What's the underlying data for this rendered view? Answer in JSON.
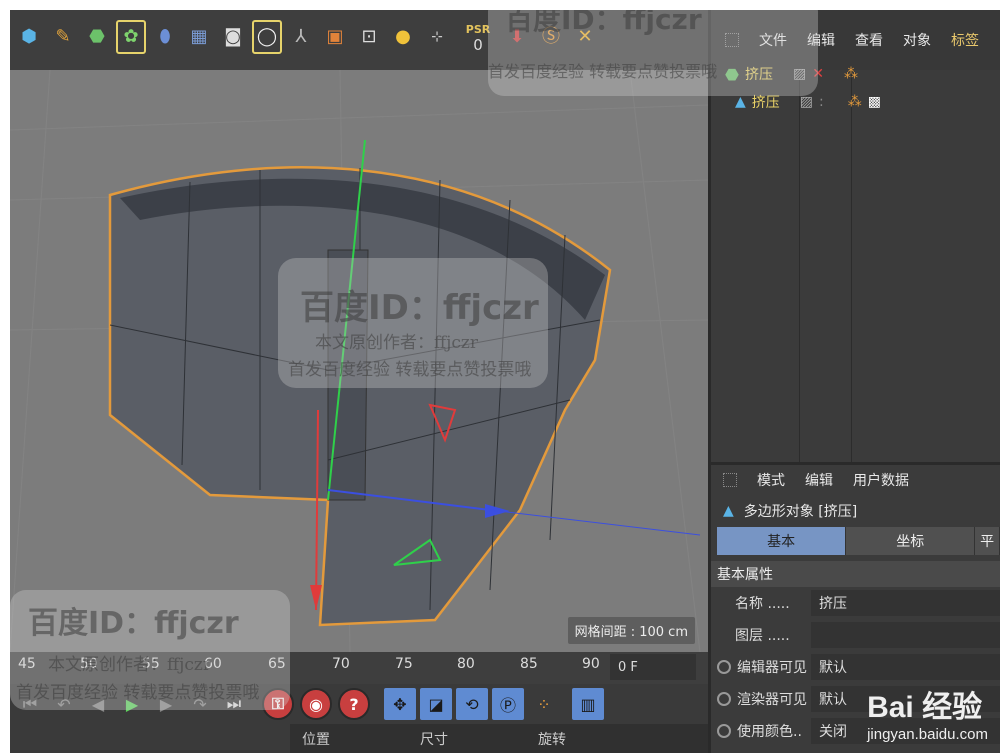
{
  "toolbar": {
    "icons": [
      "cube-icon",
      "pen-icon",
      "extrude-icon",
      "cloner-icon",
      "deformer-icon",
      "floor-icon",
      "camera-icon",
      "light-icon",
      "joint-icon",
      "render-icon",
      "render-settings-icon",
      "point-light-icon",
      "axis-icon"
    ],
    "psr_label": "PSR",
    "psr_value": "0"
  },
  "object_manager": {
    "menu": [
      "文件",
      "编辑",
      "查看",
      "对象",
      "标签"
    ],
    "active_menu": "标签",
    "objects": [
      {
        "name": "挤压",
        "icon": "extrude-icon"
      },
      {
        "name": "挤压",
        "icon": "polygon-icon"
      }
    ]
  },
  "attribute_manager": {
    "menu": [
      "模式",
      "编辑",
      "用户数据"
    ],
    "object_title": "多边形对象 [挤压]",
    "tabs": [
      "基本",
      "坐标",
      "平"
    ],
    "section": "基本属性",
    "fields": [
      {
        "label": "名称 .....",
        "value": "挤压"
      },
      {
        "label": "图层 .....",
        "value": ""
      },
      {
        "label": "编辑器可见",
        "value": "默认"
      },
      {
        "label": "渲染器可见",
        "value": "默认"
      },
      {
        "label": "使用颜色..",
        "value": "关闭"
      }
    ]
  },
  "viewport": {
    "grid_spacing": "网格间距 : 100 cm"
  },
  "timeline": {
    "ticks": [
      "45",
      "50",
      "55",
      "60",
      "65",
      "70",
      "75",
      "80",
      "85",
      "90"
    ],
    "current_frame": "0 F"
  },
  "coord_bar": [
    "位置",
    "尺寸",
    "旋转"
  ],
  "watermark": {
    "title": "百度ID：ffjczr",
    "line1": "本文原创作者：ffjczr",
    "line2": "首发百度经验 转载要点赞投票哦"
  },
  "baidu": {
    "logo": "Bai 经验",
    "url": "jingyan.baidu.com"
  },
  "colors": {
    "accent": "#e9c86c",
    "selection": "#e39a3c",
    "tab_active": "#7795c4"
  }
}
